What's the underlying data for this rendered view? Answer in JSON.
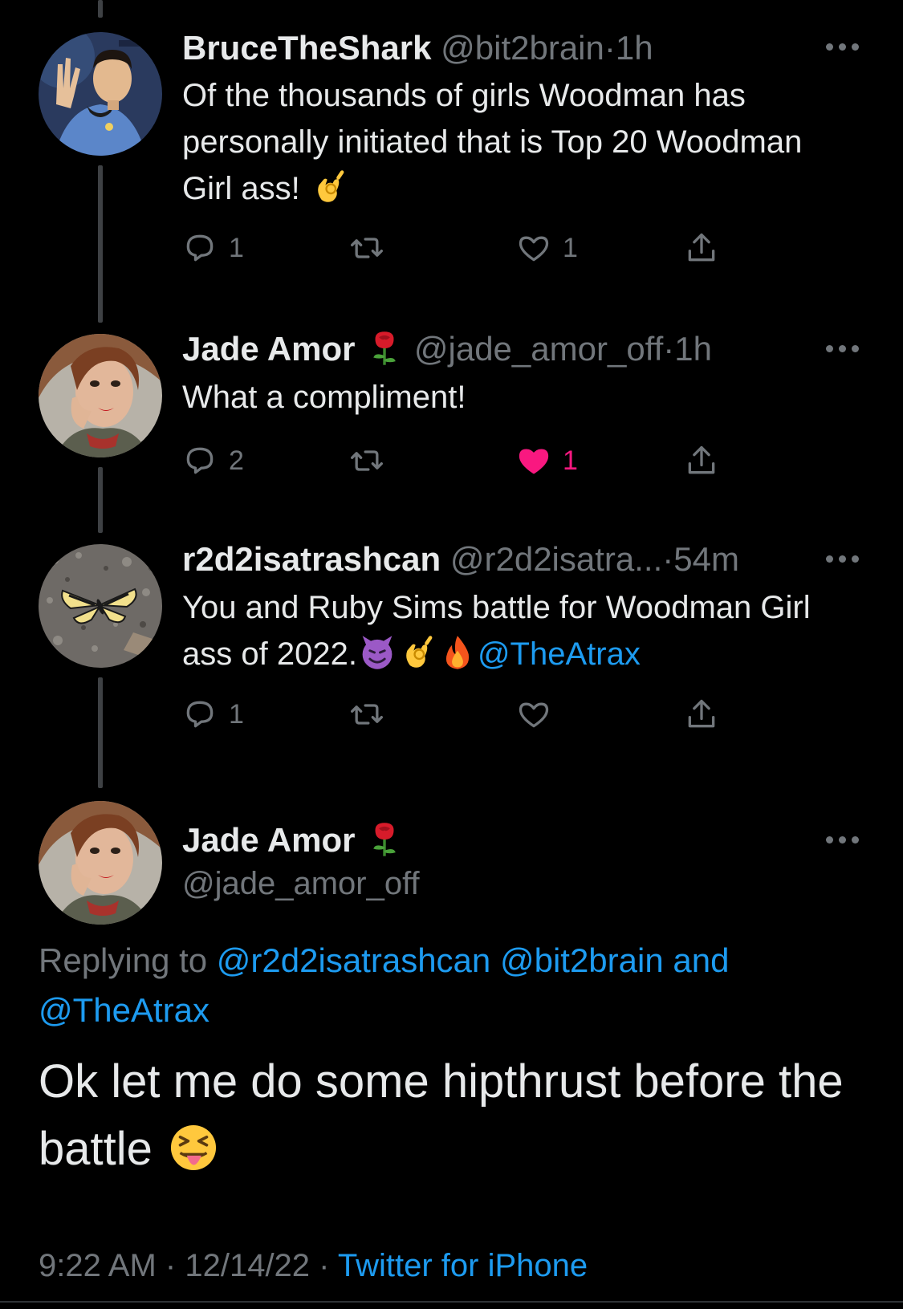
{
  "colors": {
    "background": "#000000",
    "text": "#e7e9ea",
    "muted": "#71767b",
    "link": "#1d9bf0",
    "like_active": "#f91880",
    "thread_line": "#3e4144"
  },
  "replies": [
    {
      "display_name": "BruceTheShark",
      "handle": "@bit2brain",
      "time": "1h",
      "avatar": "spock-photo",
      "text": "Of the thousands of girls Woodman has personally initiated that is Top 20 Woodman Girl ass!",
      "trailing_emoji": "ok-hand-emoji",
      "actions": {
        "replies": "1",
        "retweets": "",
        "likes": "1",
        "liked": false
      }
    },
    {
      "display_name": "Jade Amor",
      "name_emoji": "rose-emoji",
      "handle": "@jade_amor_off",
      "time": "1h",
      "avatar": "woman-selfie-photo",
      "text": "What a compliment!",
      "actions": {
        "replies": "2",
        "retweets": "",
        "likes": "1",
        "liked": true
      }
    },
    {
      "display_name": "r2d2isatrashcan",
      "handle": "@r2d2isatra...",
      "time": "54m",
      "avatar": "butterfly-on-gravel-photo",
      "text": "You and Ruby Sims battle for Woodman Girl ass of 2022.",
      "emojis": [
        "smiling-imp-emoji",
        "ok-hand-emoji",
        "fire-emoji"
      ],
      "mention": "@TheAtrax",
      "actions": {
        "replies": "1",
        "retweets": "",
        "likes": "",
        "liked": false
      }
    }
  ],
  "main_tweet": {
    "display_name": "Jade Amor",
    "name_emoji": "rose-emoji",
    "handle": "@jade_amor_off",
    "avatar": "woman-selfie-photo",
    "replying_prefix": "Replying to",
    "replying_mention_1": "@r2d2isatrashcan",
    "replying_mention_2": "@bit2brain",
    "replying_and": "and",
    "replying_mention_3": "@TheAtrax",
    "text": "Ok let me do some hipthrust before the battle",
    "trailing_emoji": "squinting-face-with-tongue-emoji",
    "time": "9:22 AM",
    "date": "12/14/22",
    "source": "Twitter for iPhone"
  },
  "separators": {
    "dot": "·"
  }
}
